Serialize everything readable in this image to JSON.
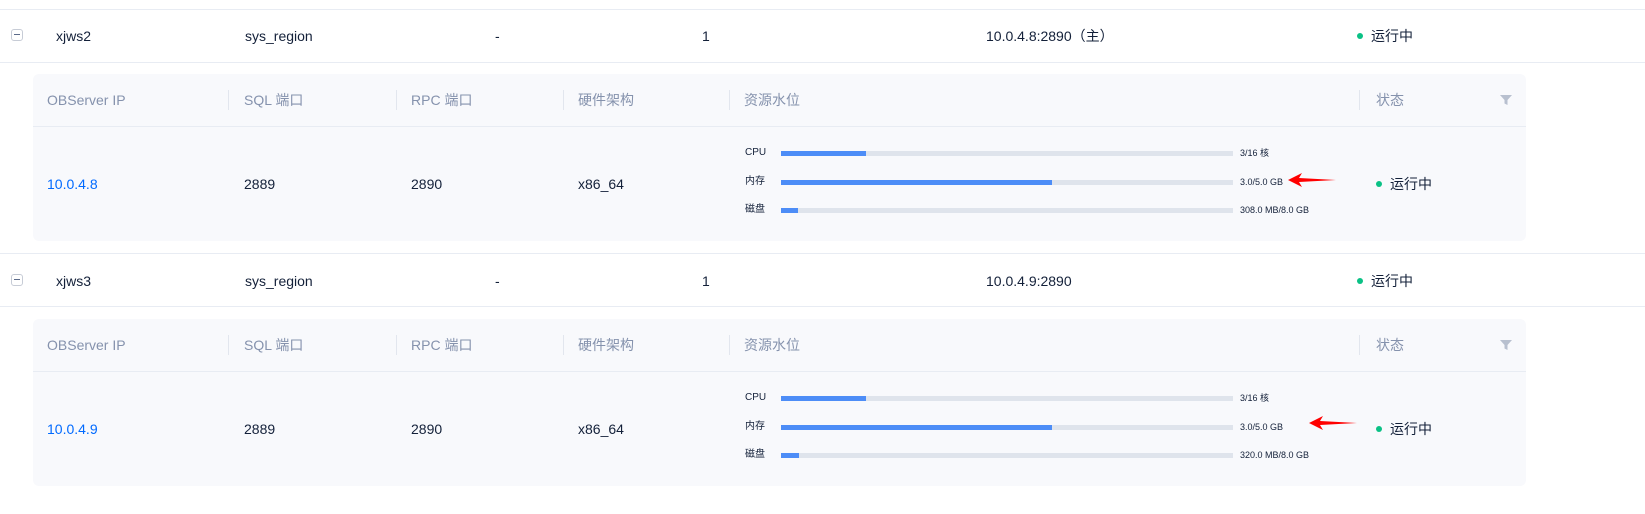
{
  "zones": [
    {
      "name": "xjws2",
      "region": "sys_region",
      "col3": "-",
      "col4": "1",
      "address": "10.0.4.8:2890（主）",
      "status": "运行中",
      "servers": {
        "headers": {
          "ip": "OBServer IP",
          "sql_port": "SQL 端口",
          "rpc_port": "RPC 端口",
          "arch": "硬件架构",
          "resource": "资源水位",
          "status": "状态"
        },
        "rows": [
          {
            "ip": "10.0.4.8",
            "sql_port": "2889",
            "rpc_port": "2890",
            "arch": "x86_64",
            "resources": [
              {
                "label": "CPU",
                "value_text": "3/16 核",
                "fraction": 0.1875
              },
              {
                "label": "内存",
                "value_text": "3.0/5.0 GB",
                "fraction": 0.6
              },
              {
                "label": "磁盘",
                "value_text": "308.0 MB/8.0 GB",
                "fraction": 0.0376
              }
            ],
            "status": "运行中"
          }
        ]
      }
    },
    {
      "name": "xjws3",
      "region": "sys_region",
      "col3": "-",
      "col4": "1",
      "address": "10.0.4.9:2890",
      "status": "运行中",
      "servers": {
        "headers": {
          "ip": "OBServer IP",
          "sql_port": "SQL 端口",
          "rpc_port": "RPC 端口",
          "arch": "硬件架构",
          "resource": "资源水位",
          "status": "状态"
        },
        "rows": [
          {
            "ip": "10.0.4.9",
            "sql_port": "2889",
            "rpc_port": "2890",
            "arch": "x86_64",
            "resources": [
              {
                "label": "CPU",
                "value_text": "3/16 核",
                "fraction": 0.1875
              },
              {
                "label": "内存",
                "value_text": "3.0/5.0 GB",
                "fraction": 0.6
              },
              {
                "label": "磁盘",
                "value_text": "320.0 MB/8.0 GB",
                "fraction": 0.039
              }
            ],
            "status": "运行中"
          }
        ]
      }
    }
  ],
  "colors": {
    "accent": "#006aff",
    "bar_fill": "#4d8df7",
    "bar_track": "#dfe4ec",
    "status_running": "#0ac185",
    "annotation_arrow": "#ff0000"
  }
}
